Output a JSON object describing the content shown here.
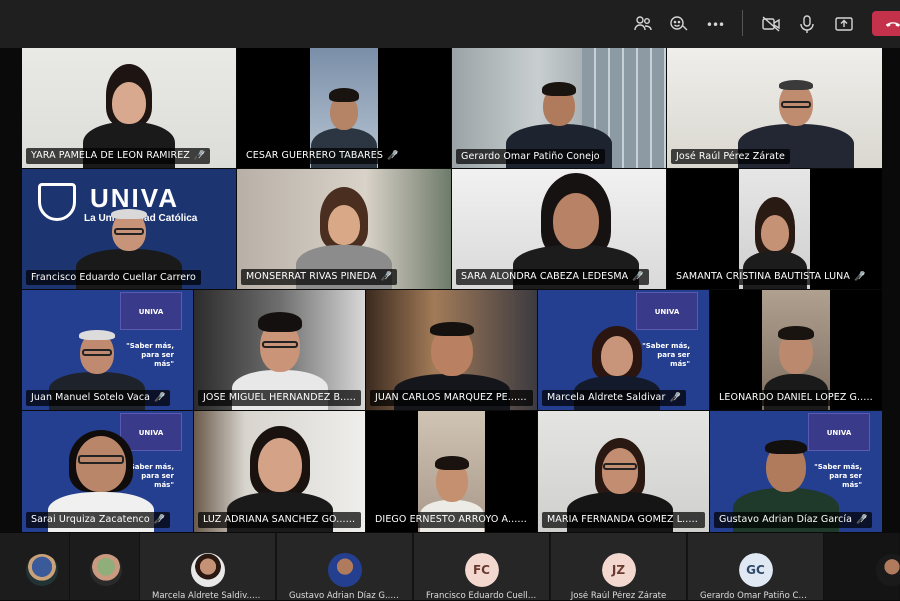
{
  "toolbar": {
    "icons": [
      "people-icon",
      "reactions-icon",
      "more-icon",
      "camera-off-icon",
      "mic-icon",
      "share-tray-icon",
      "hangup-icon"
    ],
    "more_label": "•••",
    "hangup_color": "#c4314b"
  },
  "participants": [
    {
      "name": "YARA PAMELA DE LEON RAMIREZ",
      "muted": true
    },
    {
      "name": "CESAR GUERRERO TABARES",
      "muted": true
    },
    {
      "name": "Gerardo Omar Patiño Conejo",
      "muted": false
    },
    {
      "name": "José Raúl Pérez Zárate",
      "muted": false
    },
    {
      "name": "Francisco Eduardo Cuellar Carrero",
      "muted": false
    },
    {
      "name": "MONSERRAT RIVAS PINEDA",
      "muted": true
    },
    {
      "name": "SARA ALONDRA CABEZA LEDESMA",
      "muted": true
    },
    {
      "name": "SAMANTA CRISTINA BAUTISTA LUNA",
      "muted": true
    },
    {
      "name": "Juan Manuel Sotelo Vaca",
      "muted": true
    },
    {
      "name": "JOSE MIGUEL HERNANDEZ B...",
      "muted": true
    },
    {
      "name": "JUAN CARLOS MARQUEZ PE...",
      "muted": true
    },
    {
      "name": "Marcela Aldrete Saldivar",
      "muted": true
    },
    {
      "name": "LEONARDO DANIEL LOPEZ G...",
      "muted": true
    },
    {
      "name": "Sarai Urquiza Zacatenco",
      "muted": true
    },
    {
      "name": "LUZ ADRIANA SANCHEZ GO...",
      "muted": true
    },
    {
      "name": "DIEGO ERNESTO ARROYO A...",
      "muted": true
    },
    {
      "name": "MARIA FERNANDA GOMEZ L...",
      "muted": true
    },
    {
      "name": "Gustavo Adrian Díaz García",
      "muted": true
    }
  ],
  "branding": {
    "univa_big": "UNIVA",
    "univa_sub": "La Universidad Católica",
    "univa_small": "UNIVA",
    "slogan": "\"Saber más, para ser más\""
  },
  "bottom_strip": [
    {
      "name": "",
      "kind": "photo"
    },
    {
      "name": "",
      "kind": "photo"
    },
    {
      "name": "Marcela Aldrete Saldiv...",
      "kind": "photo"
    },
    {
      "name": "Gustavo Adrian Díaz G...",
      "kind": "photo"
    },
    {
      "name": "Francisco Eduardo Cuellar ...",
      "kind": "initials",
      "initials": "FC"
    },
    {
      "name": "José Raúl Pérez Zárate",
      "kind": "initials",
      "initials": "JZ"
    },
    {
      "name": "Gerardo Omar Patiño Con...",
      "kind": "initials",
      "initials": "GC"
    },
    {
      "name": "",
      "kind": "photo"
    }
  ],
  "mic_muted_glyph": "🎙̸"
}
